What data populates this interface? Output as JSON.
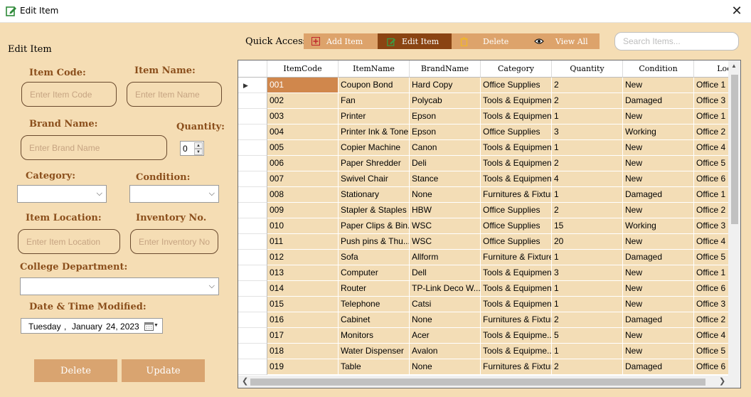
{
  "window": {
    "title": "Edit Item",
    "close_glyph": "✕"
  },
  "form": {
    "panel_title": "Edit Item",
    "item_code": {
      "label": "Item Code:",
      "placeholder": "Enter Item Code"
    },
    "item_name": {
      "label": "Item Name:",
      "placeholder": "Enter Item Name"
    },
    "brand_name": {
      "label": "Brand Name:",
      "placeholder": "Enter Brand Name"
    },
    "quantity": {
      "label": "Quantity:",
      "value": "0"
    },
    "category": {
      "label": "Category:",
      "value": ""
    },
    "condition": {
      "label": "Condition:",
      "value": ""
    },
    "item_location": {
      "label": "Item Location:",
      "placeholder": "Enter Item Location"
    },
    "inventory_no": {
      "label": "Inventory No.",
      "placeholder": "Enter Inventory No"
    },
    "college_department": {
      "label": "College Department:",
      "value": ""
    },
    "date_modified": {
      "label": "Date & Time Modified:",
      "weekday": "Tuesday",
      "sep": ",",
      "month": "January",
      "day_year": "24, 2023"
    },
    "delete_label": "Delete",
    "update_label": "Update"
  },
  "quick_access": {
    "label": "Quick Access:",
    "buttons": [
      {
        "label": "Add Item",
        "icon": "add-icon"
      },
      {
        "label": "Edit Item",
        "icon": "edit-icon",
        "active": true
      },
      {
        "label": "Delete",
        "icon": "trash-icon"
      },
      {
        "label": "View All",
        "icon": "eye-icon"
      }
    ]
  },
  "search": {
    "placeholder": "Search Items..."
  },
  "table": {
    "columns": [
      "ItemCode",
      "ItemName",
      "BrandName",
      "Category",
      "Quantity",
      "Condition",
      "Locati"
    ],
    "rows": [
      [
        "001",
        "Coupon Bond",
        "Hard Copy",
        "Office Supplies",
        "2",
        "New",
        "Office 1"
      ],
      [
        "002",
        "Fan",
        "Polycab",
        "Tools & Equipment",
        "2",
        "Damaged",
        "Office 3"
      ],
      [
        "003",
        "Printer",
        "Epson",
        "Tools & Equipment",
        "1",
        "New",
        "Office 1"
      ],
      [
        "004",
        "Printer Ink & Toner",
        "Epson",
        "Office Supplies",
        "3",
        "Working",
        "Office 2"
      ],
      [
        "005",
        "Copier Machine",
        "Canon",
        "Tools & Equipment",
        "1",
        "New",
        "Office 4"
      ],
      [
        "006",
        "Paper Shredder",
        "Deli",
        "Tools & Equipment",
        "2",
        "New",
        "Office 5"
      ],
      [
        "007",
        "Swivel Chair",
        "Stance",
        "Tools & Equipment",
        "4",
        "New",
        "Office 6"
      ],
      [
        "008",
        "Stationary",
        "None",
        "Furnitures & Fixtur...",
        "1",
        "Damaged",
        "Office 1"
      ],
      [
        "009",
        "Stapler & Staples",
        "HBW",
        "Office Supplies",
        "2",
        "New",
        "Office 2"
      ],
      [
        "010",
        "Paper Clips & Bin...",
        "WSC",
        "Office Supplies",
        "15",
        "Working",
        "Office 3"
      ],
      [
        "011",
        "Push pins & Thu...",
        "WSC",
        "Office Supplies",
        "20",
        "New",
        "Office 4"
      ],
      [
        "012",
        "Sofa",
        "Allform",
        "Furniture & Fixtures",
        "1",
        "Damaged",
        "Office 5"
      ],
      [
        "013",
        "Computer",
        "Dell",
        "Tools & Equipment",
        "3",
        "New",
        "Office 1"
      ],
      [
        "014",
        "Router",
        "TP-Link Deco W...",
        "Tools & Equipment",
        "1",
        "New",
        "Office 6"
      ],
      [
        "015",
        "Telephone",
        "Catsi",
        "Tools & Equipment",
        "1",
        "New",
        "Office 3"
      ],
      [
        "016",
        "Cabinet",
        "None",
        "Furnitures & Fixtur...",
        "2",
        "Damaged",
        "Office 2"
      ],
      [
        "017",
        "Monitors",
        "Acer",
        "Tools & Equipme...",
        "5",
        "New",
        "Office 4"
      ],
      [
        "018",
        "Water Dispenser",
        "Avalon",
        "Tools & Equipme...",
        "1",
        "New",
        "Office 5"
      ],
      [
        "019",
        "Table",
        "None",
        "Furnitures & Fixtur...",
        "2",
        "Damaged",
        "Office 6"
      ]
    ]
  },
  "colors": {
    "background": "#f5ddb4",
    "accent": "#dda36b",
    "active": "#8a4413",
    "label": "#8b4f1c",
    "selected_cell": "#d0874c"
  }
}
